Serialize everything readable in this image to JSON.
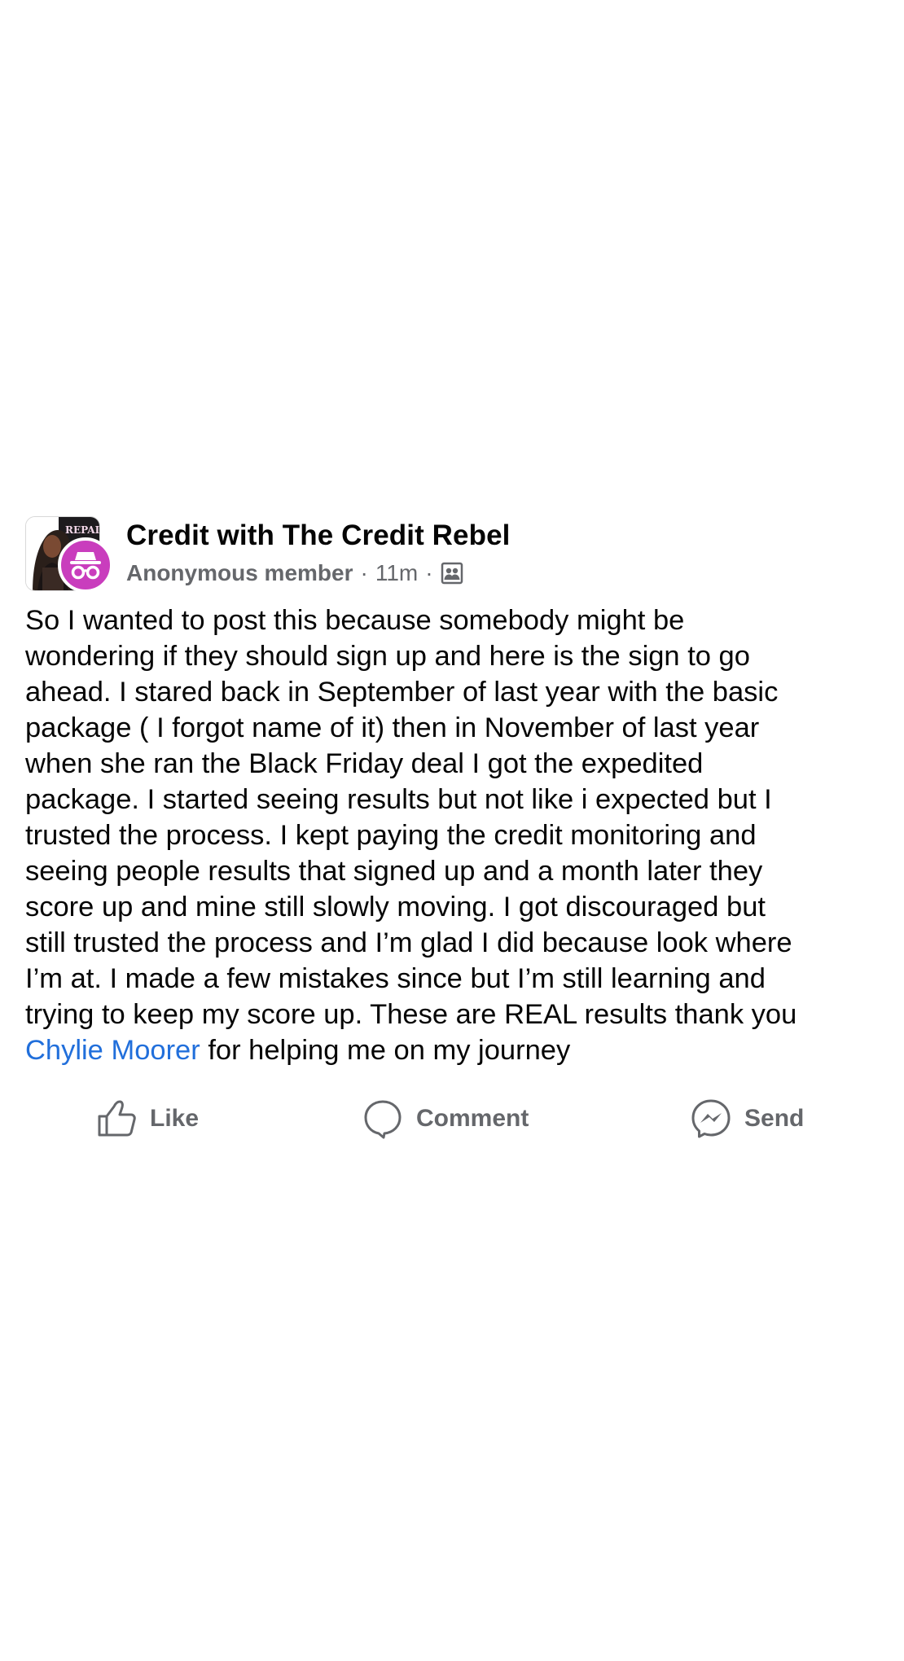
{
  "post": {
    "group_name": "Credit with The Credit Rebel",
    "author": "Anonymous member",
    "time": "11m",
    "separator": "·",
    "audience_icon": "group-audience-icon",
    "avatar_label": "REPAI",
    "body_text": "So I wanted to post this because somebody might be\nwondering if they should sign up and here is the sign to go\nahead. I stared back in September of last year with the basic\npackage ( I forgot name of it) then in November of last year\nwhen she ran the Black Friday deal I got the expedited\npackage. I started seeing results but not like i expected but I\ntrusted the process. I kept paying the credit monitoring and\nseeing people results that signed up and a month later they\nscore up and mine still slowly moving. I got discouraged but\nstill trusted the process and I’m glad I did because look where\nI’m at. I made a few mistakes since but I’m still learning and\ntrying to keep my score up. These are REAL results thank you\n",
    "mention": "Chylie Moorer",
    "body_tail": " for helping me on my journey"
  },
  "actions": {
    "like_label": "Like",
    "comment_label": "Comment",
    "send_label": "Send"
  },
  "colors": {
    "mention": "#216fdb",
    "meta": "#65676b",
    "anon_badge": "#c93dbd"
  }
}
